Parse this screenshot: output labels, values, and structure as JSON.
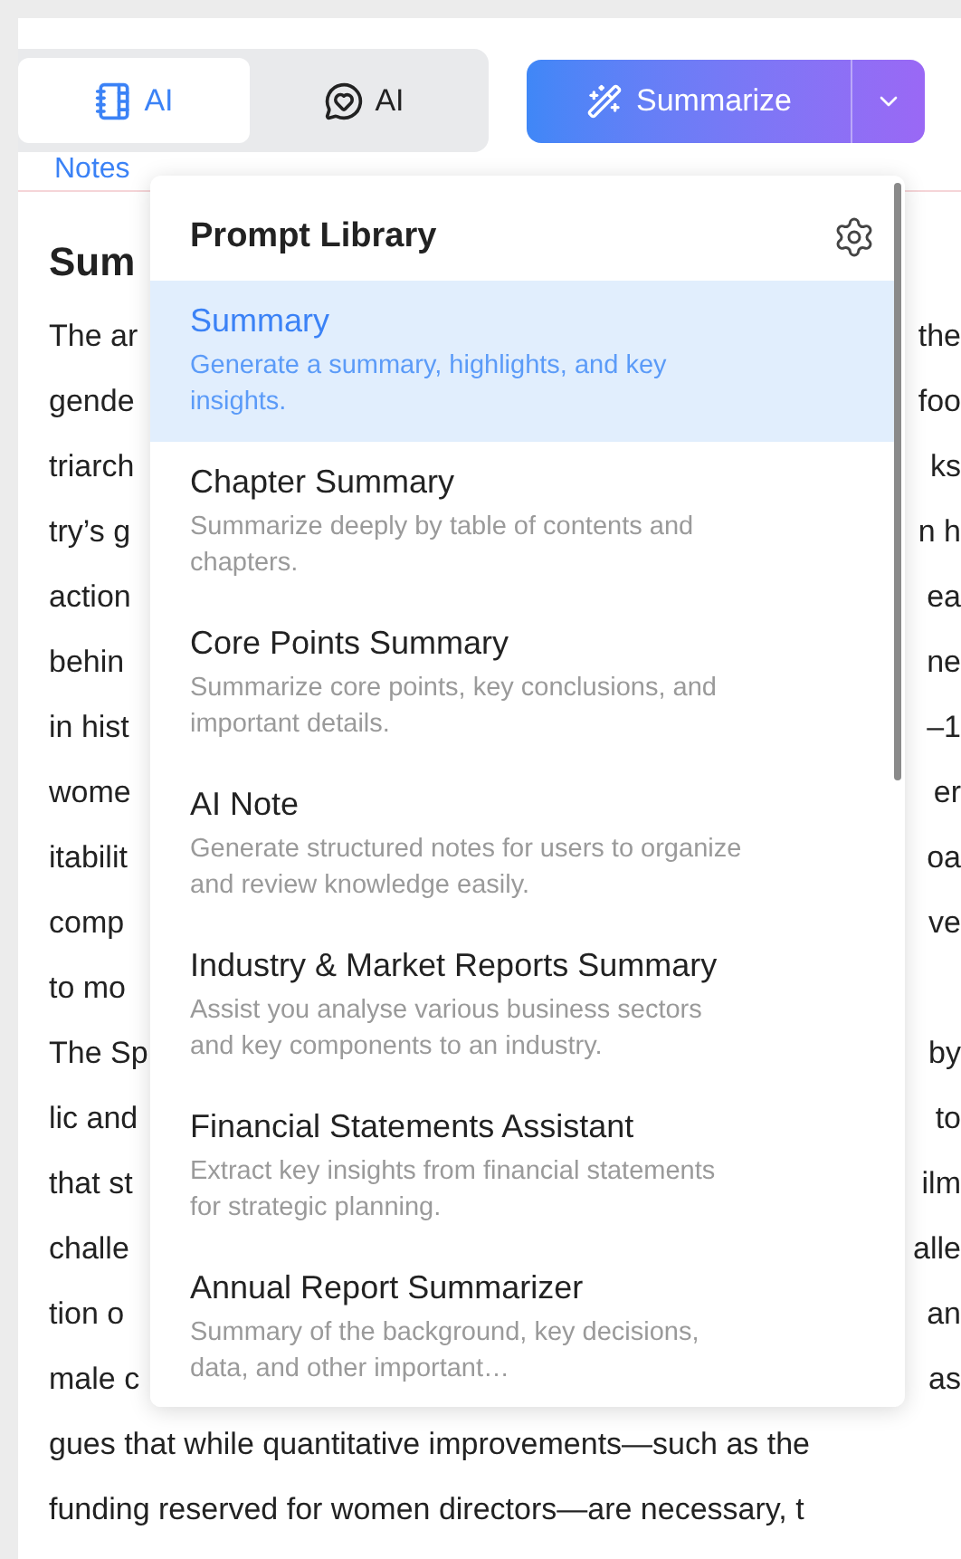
{
  "tabs": [
    {
      "label": "AI",
      "sublabel": "Notes",
      "kind": "notebook",
      "selected": true
    },
    {
      "label": "AI",
      "kind": "chat",
      "selected": false
    }
  ],
  "summarize_button": {
    "label": "Summarize"
  },
  "article": {
    "heading": "Sum",
    "lines": [
      {
        "left": "The ar",
        "right": "the"
      },
      {
        "left": "gende",
        "right": "foo"
      },
      {
        "left": "triarch",
        "right": "ks"
      },
      {
        "left": "try’s g",
        "right": "n h"
      },
      {
        "left": "action",
        "right": "ea"
      },
      {
        "left": "behin",
        "right": "ne"
      },
      {
        "left": "in hist",
        "right": "–1"
      },
      {
        "left": "wome",
        "right": "er"
      },
      {
        "left": "itabilit",
        "right": "oa"
      },
      {
        "left": "comp",
        "right": "ve"
      },
      {
        "left": "to mo"
      },
      {
        "left": "The Sp",
        "right": "by"
      },
      {
        "left": "lic and",
        "right": "to"
      },
      {
        "left": "that st",
        "right": "ilm"
      },
      {
        "left": "challe",
        "right": "alle"
      },
      {
        "left": "tion o",
        "right": "an"
      },
      {
        "left": "male c",
        "right": "as"
      }
    ],
    "full_lines": [
      "gues that while quantitative improvements—such as the",
      "funding reserved for women directors—are necessary, t"
    ]
  },
  "prompt_library": {
    "title": "Prompt Library",
    "items": [
      {
        "title": "Summary",
        "description": "Generate a summary, highlights, and key insights.",
        "selected": true
      },
      {
        "title": "Chapter Summary",
        "description": "Summarize deeply by table of contents and chapters.",
        "selected": false
      },
      {
        "title": "Core Points Summary",
        "description": "Summarize core points, key conclusions, and important details.",
        "selected": false
      },
      {
        "title": "AI Note",
        "description": "Generate structured notes for users to organize and review knowledge easily.",
        "selected": false
      },
      {
        "title": "Industry & Market Reports Summary",
        "description": "Assist you analyse various business sectors and key components to an industry.",
        "selected": false
      },
      {
        "title": "Financial Statements Assistant",
        "description": "Extract key insights from financial statements for strategic planning.",
        "selected": false
      },
      {
        "title": "Annual Report Summarizer",
        "description": "Summary of the background, key decisions, data, and other important…",
        "selected": false
      }
    ]
  }
}
